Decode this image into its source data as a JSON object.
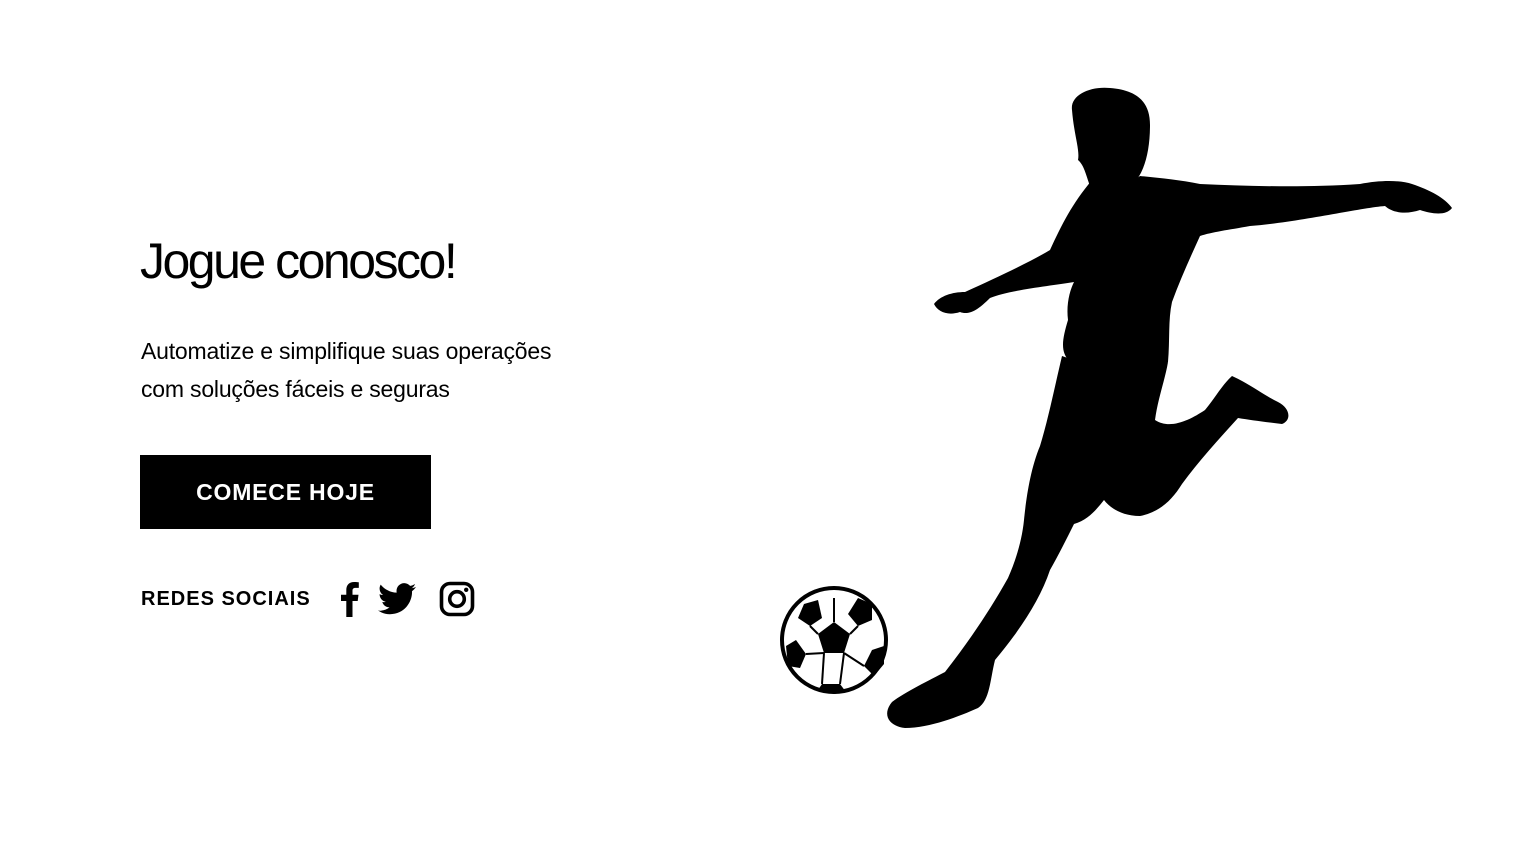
{
  "hero": {
    "title": "Jogue conosco!",
    "subtitle_lines": [
      "Automatize e simplifique suas operações",
      "com soluções fáceis e seguras"
    ],
    "cta_label": "COMECE HOJE"
  },
  "social": {
    "label": "REDES SOCIAIS",
    "links": [
      {
        "icon": "facebook-icon"
      },
      {
        "icon": "twitter-icon"
      },
      {
        "icon": "instagram-icon"
      }
    ]
  },
  "illustration": {
    "subject": "soccer-player-silhouette",
    "ball": "soccer-ball"
  },
  "colors": {
    "background": "#ffffff",
    "text": "#000000",
    "button_bg": "#000000",
    "button_text": "#ffffff"
  }
}
